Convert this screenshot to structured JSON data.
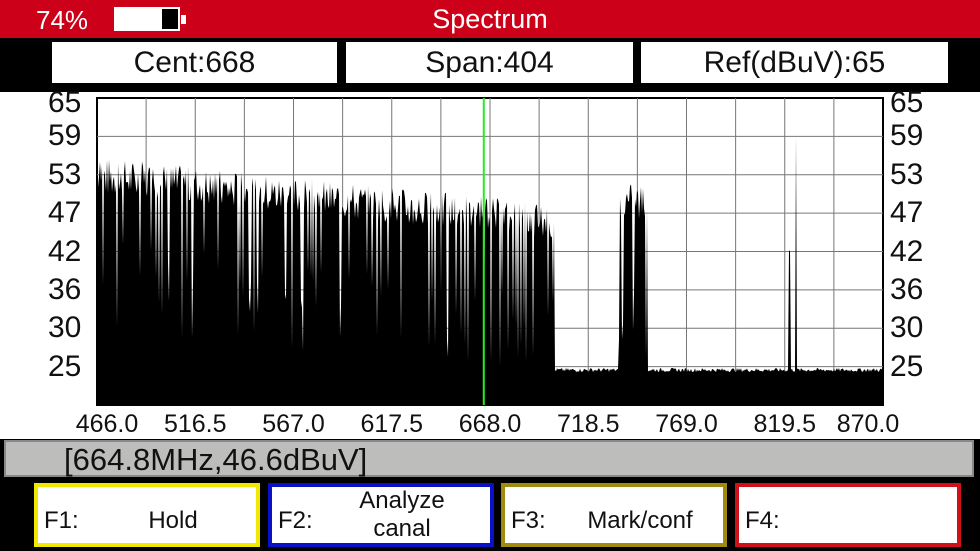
{
  "header": {
    "battery_percent": "74%",
    "battery_level": 0.26,
    "title": "Spectrum"
  },
  "params": {
    "center": "Cent:668",
    "span": "Span:404",
    "ref": "Ref(dBuV):65"
  },
  "status": {
    "readout": "[664.8MHz,46.6dBuV]"
  },
  "fkeys": [
    {
      "key": "F1:",
      "label": "Hold",
      "color": "#f0e800"
    },
    {
      "key": "F2:",
      "label": "Analyze canal",
      "line1": "Analyze",
      "line2": "canal",
      "color": "#0a10c8"
    },
    {
      "key": "F3:",
      "label": "Mark/conf",
      "color": "#a08a10"
    },
    {
      "key": "F4:",
      "label": "",
      "color": "#d0101a"
    }
  ],
  "chart_data": {
    "type": "area",
    "title": "Spectrum",
    "xlabel": "MHz",
    "ylabel": "dBuV",
    "x_ticks": [
      "466.0",
      "516.5",
      "567.0",
      "617.5",
      "668.0",
      "718.5",
      "769.0",
      "819.5",
      "870.0"
    ],
    "y_ticks": [
      "65",
      "59",
      "53",
      "47",
      "42",
      "36",
      "30",
      "25"
    ],
    "xlim": [
      466,
      870
    ],
    "ylim": [
      20.1,
      65.7
    ],
    "marker_mhz": 664.8,
    "marker_color": "#22ee22",
    "noise_floor_dbuv": 25,
    "segments": [
      {
        "from": 466,
        "to": 701,
        "level_start": 53,
        "level_end": 46,
        "kind": "channels"
      },
      {
        "from": 701,
        "to": 734,
        "level_start": 25,
        "level_end": 25,
        "kind": "floor"
      },
      {
        "from": 734,
        "to": 749,
        "level_start": 49,
        "level_end": 49,
        "kind": "channels"
      },
      {
        "from": 749,
        "to": 870,
        "level_start": 25,
        "level_end": 25,
        "kind": "floor"
      }
    ],
    "spikes": [
      {
        "mhz": 822,
        "dbuv": 43
      },
      {
        "mhz": 825.2,
        "dbuv": 60
      }
    ]
  }
}
